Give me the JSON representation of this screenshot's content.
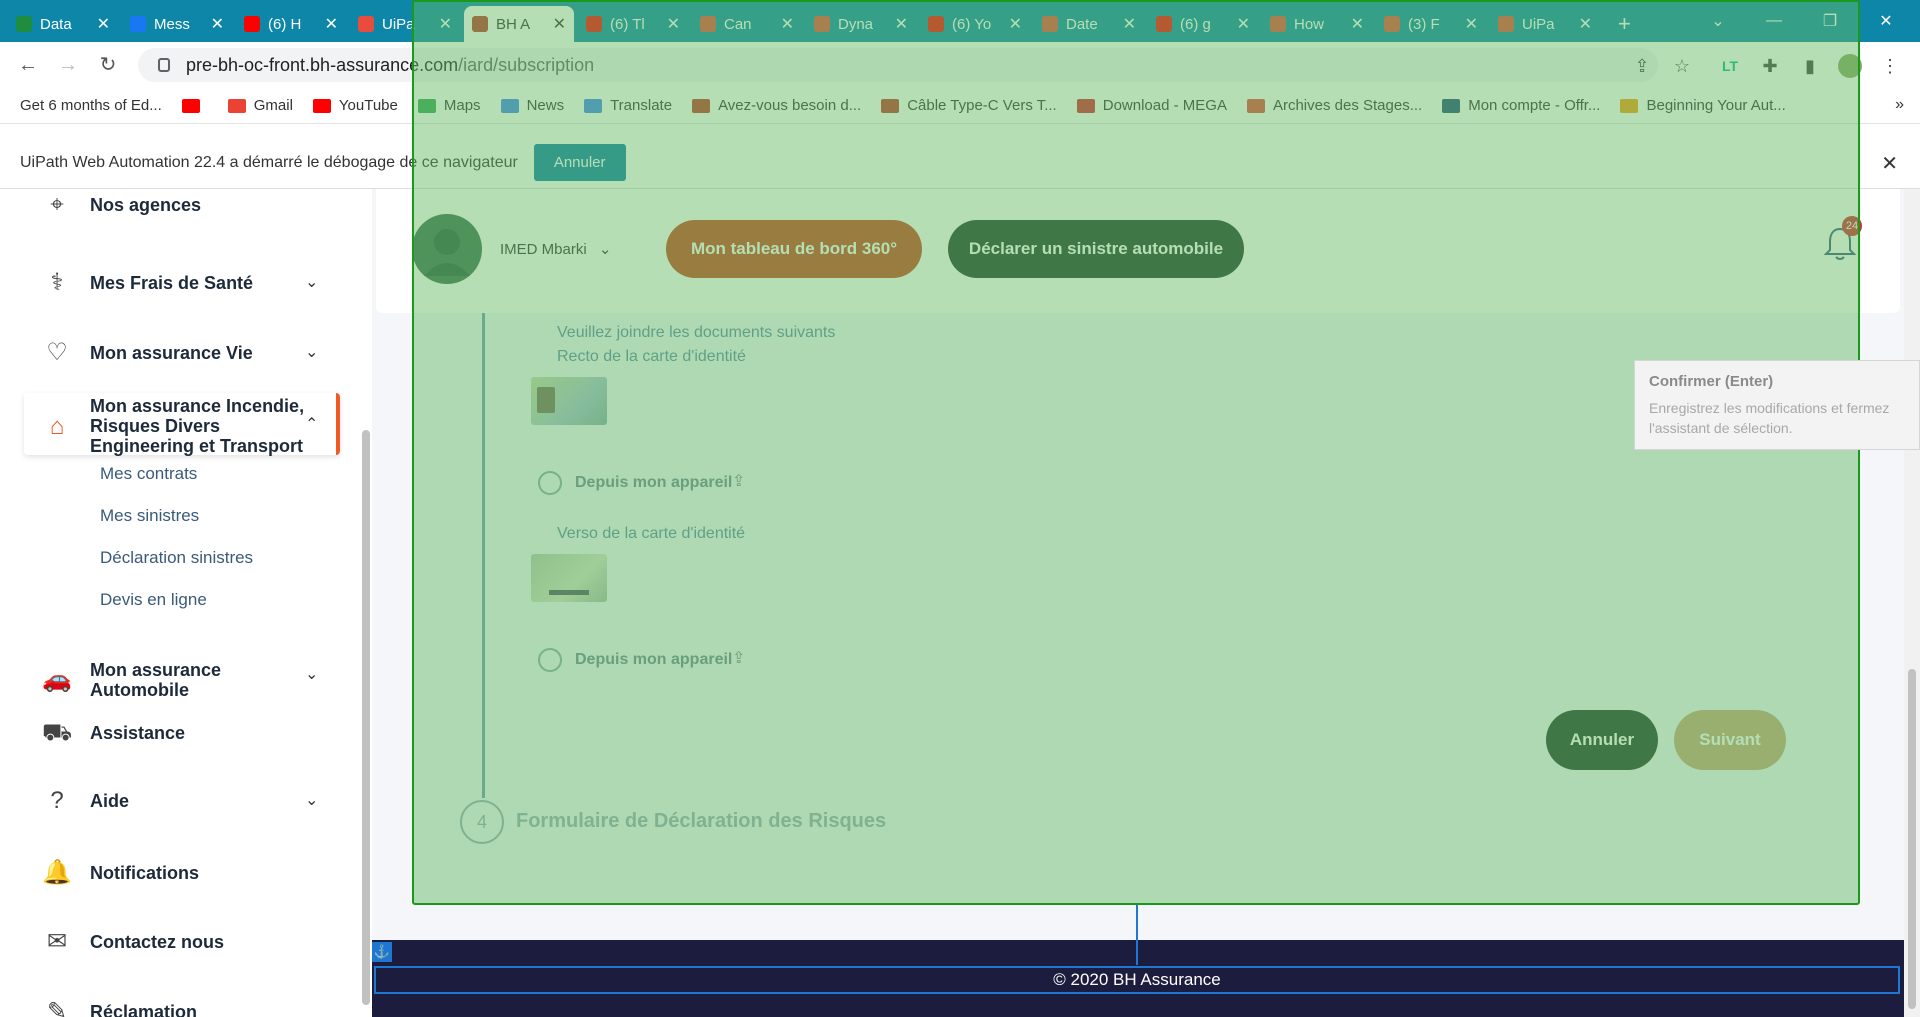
{
  "browser": {
    "tabs": [
      {
        "title": "Data",
        "color": "#1e8e3e",
        "active": false
      },
      {
        "title": "Mess",
        "color": "#1877f2",
        "active": false
      },
      {
        "title": "(6) H",
        "color": "#ff0000",
        "active": false
      },
      {
        "title": "UiPa",
        "color": "#e74c3c",
        "active": false
      },
      {
        "title": "BH A",
        "color": "#c0392b",
        "active": true
      },
      {
        "title": "(6) Tl",
        "color": "#ff0000",
        "active": false
      },
      {
        "title": "Can",
        "color": "#e74c3c",
        "active": false
      },
      {
        "title": "Dyna",
        "color": "#e74c3c",
        "active": false
      },
      {
        "title": "(6) Yo",
        "color": "#ff0000",
        "active": false
      },
      {
        "title": "Date",
        "color": "#e74c3c",
        "active": false
      },
      {
        "title": "(6) g",
        "color": "#ff0000",
        "active": false
      },
      {
        "title": "How",
        "color": "#e74c3c",
        "active": false
      },
      {
        "title": "(3) F",
        "color": "#e74c3c",
        "active": false
      },
      {
        "title": "UiPa",
        "color": "#e74c3c",
        "active": false
      }
    ],
    "new_tab": "+",
    "close_tab": "✕",
    "url_host": "pre-bh-oc-front.bh-assurance.com",
    "url_path": "/iard/subscription",
    "bookmarks": [
      {
        "label": "Get 6 months of Ed...",
        "color": ""
      },
      {
        "label": "",
        "color": "#ff0000"
      },
      {
        "label": "Gmail",
        "color": "#ea4335"
      },
      {
        "label": "YouTube",
        "color": "#ff0000"
      },
      {
        "label": "Maps",
        "color": "#34a853"
      },
      {
        "label": "News",
        "color": "#4285f4"
      },
      {
        "label": "Translate",
        "color": "#4285f4"
      },
      {
        "label": "Avez-vous besoin d...",
        "color": "#c0392b"
      },
      {
        "label": "Câble Type-C Vers T...",
        "color": "#c0392b"
      },
      {
        "label": "Download - MEGA",
        "color": "#d9272e"
      },
      {
        "label": "Archives des Stages...",
        "color": "#e74c3c"
      },
      {
        "label": "Mon compte - Offr...",
        "color": "#1f4e79"
      },
      {
        "label": "Beginning Your Aut...",
        "color": "#f39c12"
      }
    ],
    "bookmarks_more": "»"
  },
  "infobar": {
    "message": "UiPath Web Automation 22.4 a démarré le débogage de ce navigateur",
    "button": "Annuler",
    "close": "✕"
  },
  "sidebar": {
    "items": [
      {
        "label": "Nos agences",
        "icon": "location-icon",
        "glyph": "⌖"
      },
      {
        "label": "Mes Frais de Santé",
        "icon": "health-icon",
        "glyph": "⚕",
        "chevron": "⌄"
      },
      {
        "label": "Mon assurance Vie",
        "icon": "life-icon",
        "glyph": "♡",
        "chevron": "⌄"
      },
      {
        "label": "Mon assurance Automobile",
        "icon": "car-icon",
        "glyph": "🚗",
        "chevron": "⌄"
      },
      {
        "label": "Assistance",
        "icon": "assistance-icon",
        "glyph": "⛟"
      },
      {
        "label": "Aide",
        "icon": "help-icon",
        "glyph": "?",
        "chevron": "⌄"
      },
      {
        "label": "Notifications",
        "icon": "bell-icon",
        "glyph": "🔔"
      },
      {
        "label": "Contactez nous",
        "icon": "mail-icon",
        "glyph": "✉"
      },
      {
        "label": "Réclamation",
        "icon": "complaint-icon",
        "glyph": "✎"
      }
    ],
    "active": {
      "label_line1": "Mon assurance Incendie,",
      "label_line2": "Risques Divers",
      "label_line3": "Engineering et Transport",
      "icon": "home-icon",
      "glyph": "⌂",
      "chevron": "⌃"
    },
    "subitems": [
      "Mes contrats",
      "Mes sinistres",
      "Déclaration sinistres",
      "Devis en ligne"
    ]
  },
  "header": {
    "user_name": "IMED Mbarki",
    "user_chevron": "⌄",
    "btn_dashboard": "Mon tableau de bord 360°",
    "btn_declare": "Déclarer un sinistre automobile",
    "notification_count": "24"
  },
  "form": {
    "join_docs": "Veuillez joindre les documents suivants",
    "recto_label": "Recto de la carte d'identité",
    "verso_label": "Verso de la carte d'identité",
    "from_device": "Depuis mon appareil",
    "upload_glyph": "⇪",
    "btn_cancel": "Annuler",
    "btn_next": "Suivant",
    "step_number": "4",
    "step_title": "Formulaire de Déclaration des Risques"
  },
  "tooltip": {
    "title": "Confirmer (Enter)",
    "body": "Enregistrez les modifications et fermez l'assistant de sélection."
  },
  "footer": {
    "copyright": "© 2020 BH Assurance",
    "anchor": "⚓"
  }
}
